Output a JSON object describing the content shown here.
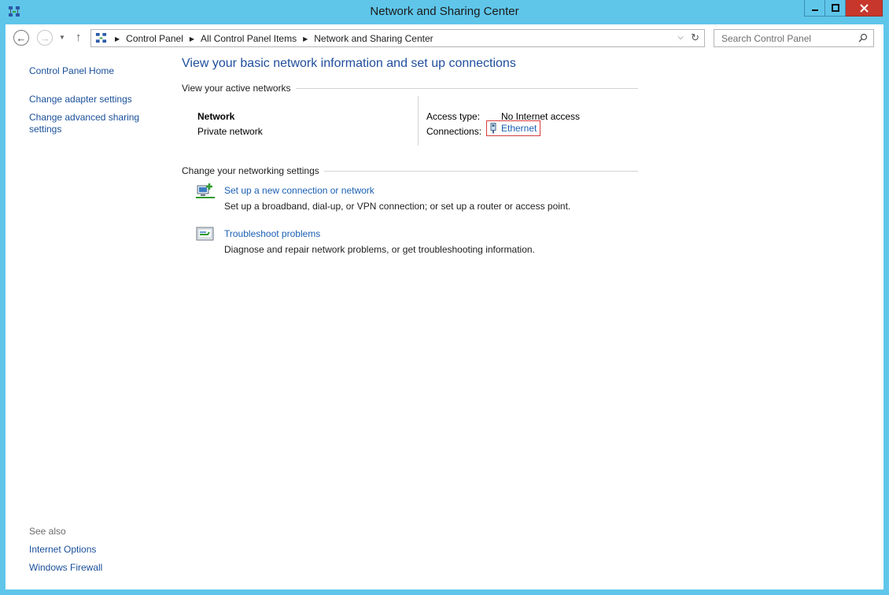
{
  "window": {
    "title": "Network and Sharing Center"
  },
  "address": {
    "crumbs": [
      "Control Panel",
      "All Control Panel Items",
      "Network and Sharing Center"
    ]
  },
  "search": {
    "placeholder": "Search Control Panel"
  },
  "sidebar": {
    "home": "Control Panel Home",
    "links": [
      "Change adapter settings",
      "Change advanced sharing settings"
    ],
    "see_also_label": "See also",
    "see_also": [
      "Internet Options",
      "Windows Firewall"
    ]
  },
  "main": {
    "heading": "View your basic network information and set up connections",
    "active_networks_title": "View your active networks",
    "network": {
      "name": "Network",
      "category": "Private network",
      "access_label": "Access type:",
      "access_value": "No Internet access",
      "connections_label": "Connections:",
      "connection_name": "Ethernet"
    },
    "settings_title": "Change your networking settings",
    "tasks": [
      {
        "link": "Set up a new connection or network",
        "desc": "Set up a broadband, dial-up, or VPN connection; or set up a router or access point.",
        "icon": "new-connection-icon"
      },
      {
        "link": "Troubleshoot problems",
        "desc": "Diagnose and repair network problems, or get troubleshooting information.",
        "icon": "troubleshoot-icon"
      }
    ]
  },
  "colors": {
    "frame": "#5fc6ea",
    "link": "#1a5fb4",
    "heading": "#1f4e9c",
    "highlight": "#d63b3b",
    "close": "#c7372c"
  }
}
